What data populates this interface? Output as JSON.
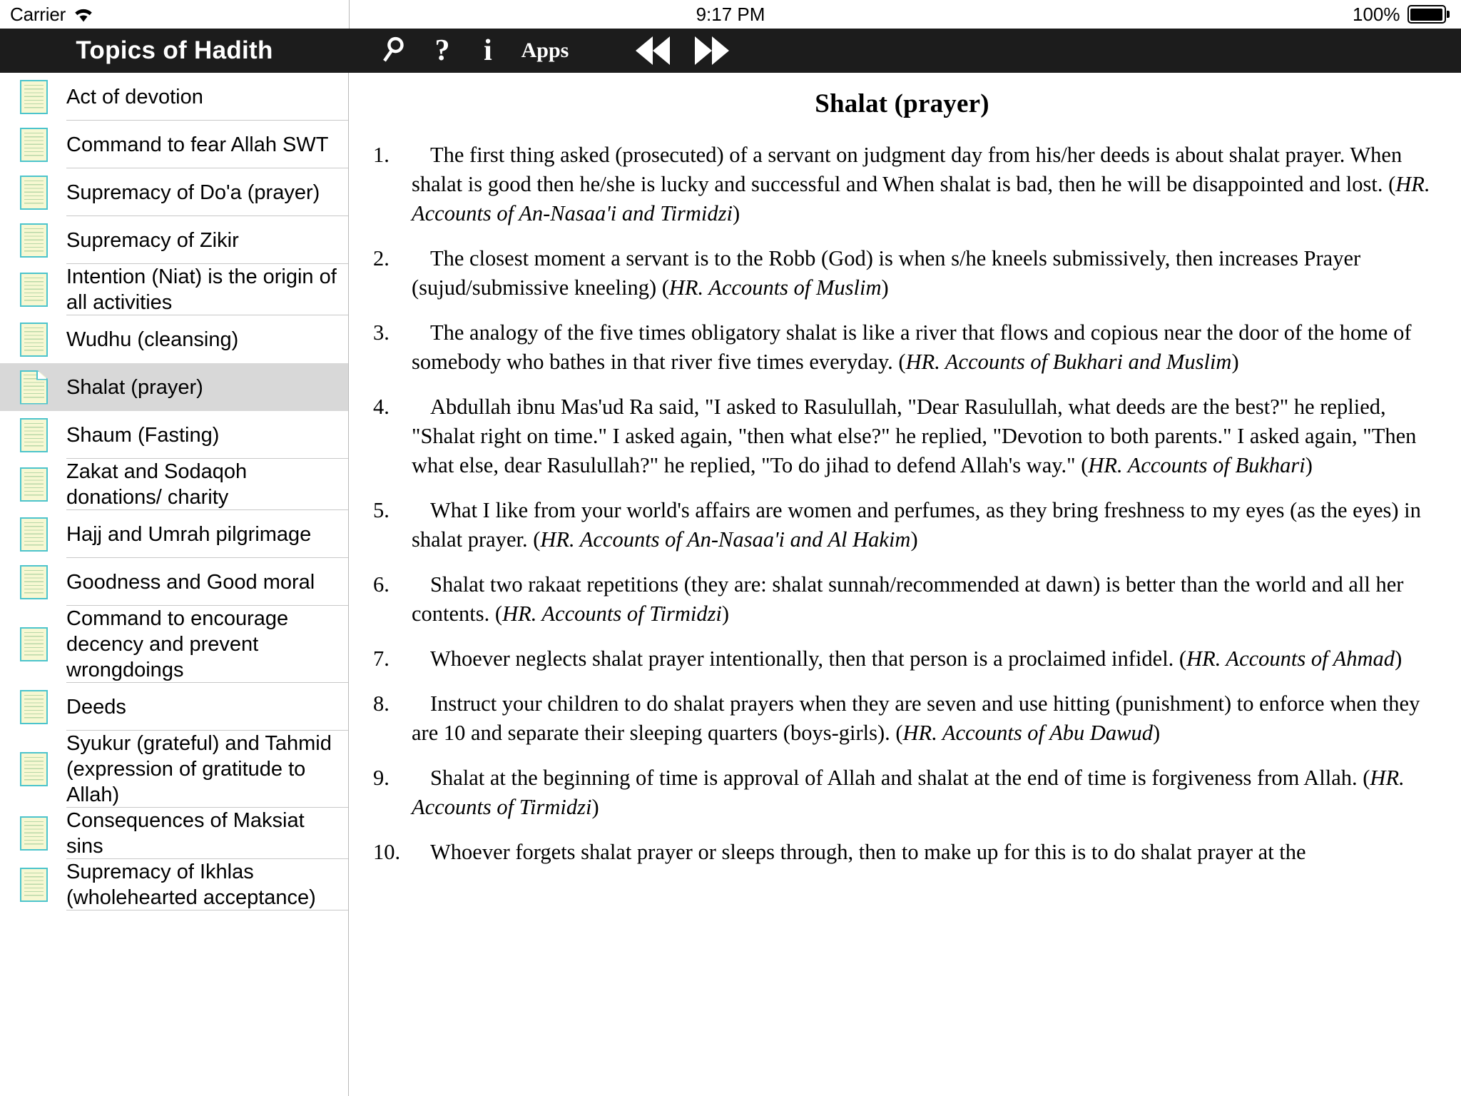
{
  "statusbar": {
    "carrier": "Carrier",
    "wifi_icon": "wifi-icon",
    "time": "9:17 PM",
    "battery_percent": "100%",
    "battery_icon": "battery-full-icon"
  },
  "navbar": {
    "title": "Topics of Hadith",
    "tools": [
      {
        "name": "search-icon",
        "label": ""
      },
      {
        "name": "help-icon",
        "label": "?"
      },
      {
        "name": "info-icon",
        "label": "i"
      },
      {
        "name": "apps-button",
        "label": "Apps"
      },
      {
        "name": "previous-icon",
        "label": ""
      },
      {
        "name": "next-icon",
        "label": ""
      }
    ]
  },
  "sidebar": {
    "items": [
      {
        "label": "Act of devotion",
        "selected": false
      },
      {
        "label": "Command to fear Allah SWT",
        "selected": false
      },
      {
        "label": "Supremacy of Do'a (prayer)",
        "selected": false
      },
      {
        "label": "Supremacy of Zikir",
        "selected": false
      },
      {
        "label": "Intention (Niat) is the origin of all activities",
        "selected": false
      },
      {
        "label": "Wudhu (cleansing)",
        "selected": false
      },
      {
        "label": "Shalat (prayer)",
        "selected": true
      },
      {
        "label": "Shaum (Fasting)",
        "selected": false
      },
      {
        "label": "Zakat and Sodaqoh donations/ charity",
        "selected": false
      },
      {
        "label": "Hajj and Umrah pilgrimage",
        "selected": false
      },
      {
        "label": "Goodness and Good moral",
        "selected": false
      },
      {
        "label": "Command to encourage decency and prevent wrongdoings",
        "selected": false
      },
      {
        "label": "Deeds",
        "selected": false
      },
      {
        "label": "Syukur (grateful) and Tahmid (expression of gratitude to Allah)",
        "selected": false
      },
      {
        "label": "Consequences of Maksiat sins",
        "selected": false
      },
      {
        "label": "Supremacy of Ikhlas (wholehearted acceptance)",
        "selected": false
      }
    ]
  },
  "main": {
    "title": "Shalat (prayer)",
    "hadiths": [
      {
        "num": "1.",
        "body": "The first thing asked (prosecuted) of a servant on judgment day from his/her deeds is about shalat prayer. When shalat is good then he/she is lucky and successful and When shalat is bad, then he will be disappointed and lost. (",
        "citation": "HR. Accounts of An-Nasaa'i and Tirmidzi",
        "tail": ")"
      },
      {
        "num": "2.",
        "body": "The closest moment a servant is to the Robb (God) is when s/he kneels submissively, then increases Prayer (sujud/submissive kneeling) (",
        "citation": "HR. Accounts of Muslim",
        "tail": ")"
      },
      {
        "num": "3.",
        "body": "The analogy of the five times obligatory shalat is like a river that flows and copious near the door of the home of somebody who bathes in that river five times everyday. (",
        "citation": "HR. Accounts of Bukhari and Muslim",
        "tail": ")"
      },
      {
        "num": "4.",
        "body": "Abdullah ibnu Mas'ud Ra said, \"I asked to Rasulullah, \"Dear Rasulullah, what deeds are the best?\" he replied, \"Shalat right on time.\" I asked again, \"then what else?\" he replied, \"Devotion to both parents.\" I asked again, \"Then what else, dear Rasulullah?\" he replied, \"To do jihad to defend Allah's way.\" (",
        "citation": "HR. Accounts of Bukhari",
        "tail": ")"
      },
      {
        "num": "5.",
        "body": "What I like from your world's affairs are women and perfumes, as they bring freshness to my eyes (as the eyes) in shalat prayer. (",
        "citation": "HR. Accounts of An-Nasaa'i and Al Hakim",
        "tail": ")"
      },
      {
        "num": "6.",
        "body": "Shalat two rakaat repetitions (they are: shalat sunnah/recommended at dawn) is better than the world and all her contents. (",
        "citation": "HR. Accounts of Tirmidzi",
        "tail": ")"
      },
      {
        "num": "7.",
        "body": "Whoever neglects shalat prayer intentionally, then that person is a proclaimed infidel. (",
        "citation": "HR. Accounts of Ahmad",
        "tail": ")"
      },
      {
        "num": "8.",
        "body": "Instruct your children to do shalat prayers when they are seven and use hitting (punishment) to enforce when they are 10 and separate their sleeping quarters (boys-girls). (",
        "citation": "HR. Accounts of Abu Dawud",
        "tail": ")"
      },
      {
        "num": "9.",
        "body": "Shalat at the beginning of time is approval of Allah and shalat at the end of time is forgiveness from Allah. (",
        "citation": "HR. Accounts of Tirmidzi",
        "tail": ")"
      },
      {
        "num": "10.",
        "body": "Whoever forgets shalat prayer or sleeps through, then to make up for this is to do shalat prayer at the",
        "citation": "",
        "tail": ""
      }
    ]
  },
  "colors": {
    "navbar_bg": "#1c1c1c",
    "selected_row_bg": "#d8d8d8",
    "icon_paper": "#f7f8d2",
    "icon_border": "#4cc4cc",
    "separator": "#c8c8c8"
  }
}
